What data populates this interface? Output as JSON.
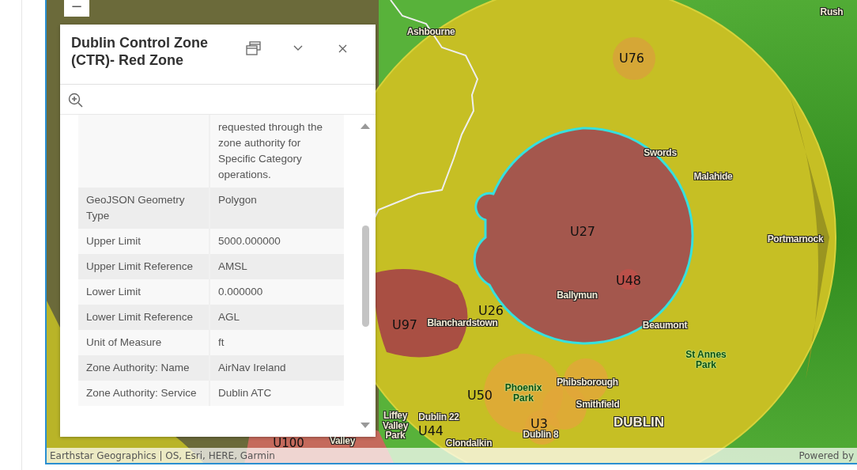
{
  "map": {
    "zoom_out_button": "−",
    "labels": [
      {
        "text": "Ashbourne",
        "kind": "place"
      },
      {
        "text": "Rush",
        "kind": "place"
      },
      {
        "text": "U76",
        "kind": "zone"
      },
      {
        "text": "Swords",
        "kind": "place"
      },
      {
        "text": "Malahide",
        "kind": "place"
      },
      {
        "text": "Portmarnock",
        "kind": "place"
      },
      {
        "text": "U27",
        "kind": "zone"
      },
      {
        "text": "U48",
        "kind": "zone"
      },
      {
        "text": "Ballymun",
        "kind": "place"
      },
      {
        "text": "Beaumont",
        "kind": "place"
      },
      {
        "text": "St Annes Park",
        "kind": "park"
      },
      {
        "text": "U26",
        "kind": "zone"
      },
      {
        "text": "U97",
        "kind": "zone"
      },
      {
        "text": "Blanchardstown",
        "kind": "place"
      },
      {
        "text": "Phibsborough",
        "kind": "place"
      },
      {
        "text": "U50",
        "kind": "zone"
      },
      {
        "text": "Phoenix Park",
        "kind": "park"
      },
      {
        "text": "Smithfield",
        "kind": "place"
      },
      {
        "text": "U3",
        "kind": "zone"
      },
      {
        "text": "DUBLIN",
        "kind": "city"
      },
      {
        "text": "Dublin 8",
        "kind": "place"
      },
      {
        "text": "Dublin 22",
        "kind": "place"
      },
      {
        "text": "U44",
        "kind": "zone"
      },
      {
        "text": "Clondalkin",
        "kind": "place"
      },
      {
        "text": "Liffey Valley Park",
        "kind": "place"
      },
      {
        "text": "U100",
        "kind": "zone"
      },
      {
        "text": "Valley",
        "kind": "place"
      }
    ],
    "attribution": "Earthstar Geographics | OS, Esri, HERE, Garmin",
    "powered_by": "Powered by"
  },
  "popup": {
    "title": "Dublin Control Zone (CTR)- Red Zone",
    "rows": [
      {
        "label": "",
        "value": "requested through the zone authority for Specific Category operations."
      },
      {
        "label": "GeoJSON Geometry Type",
        "value": "Polygon"
      },
      {
        "label": "Upper Limit",
        "value": "5000.000000"
      },
      {
        "label": "Upper Limit Reference",
        "value": "AMSL"
      },
      {
        "label": "Lower Limit",
        "value": "0.000000"
      },
      {
        "label": "Lower Limit Reference",
        "value": "AGL"
      },
      {
        "label": "Unit of Measure",
        "value": "ft"
      },
      {
        "label": "Zone Authority: Name",
        "value": "AirNav Ireland"
      },
      {
        "label": "Zone Authority: Service",
        "value": "Dublin ATC"
      }
    ]
  }
}
